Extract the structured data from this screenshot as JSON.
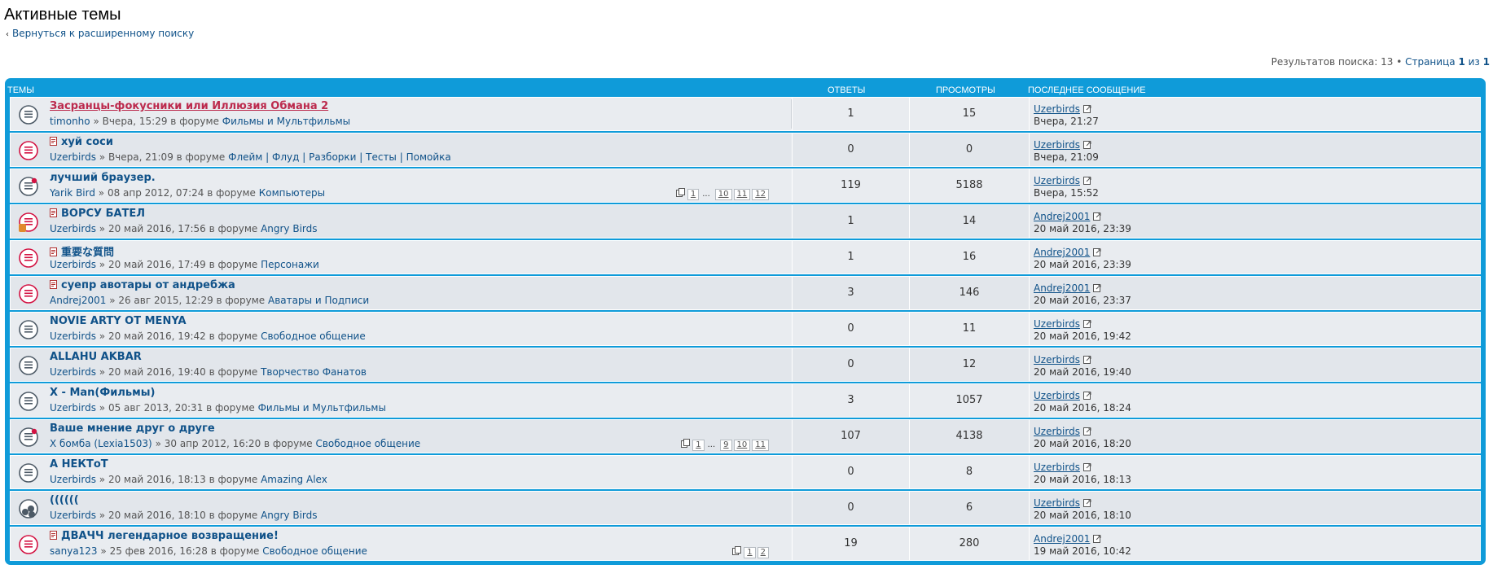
{
  "page": {
    "title": "Активные темы",
    "return_link": "Вернуться к расширенному поиску",
    "results_text": "Результатов поиска: 13",
    "separator": "•",
    "page_text": "Страница",
    "page_current": "1",
    "page_of": "из",
    "page_total": "1"
  },
  "table": {
    "headers": {
      "topics": "ТЕМЫ",
      "replies": "ОТВЕТЫ",
      "views": "ПРОСМОТРЫ",
      "last_post": "ПОСЛЕДНЕЕ СООБЩЕНИЕ"
    },
    "rows": [
      {
        "title": "Засранцы-фокусники или Иллюзия Обмана 2",
        "title_style": "red",
        "hot": false,
        "icon": "topic-read-icon",
        "author": "timonho",
        "date": "» Вчера, 15:29 в форуме",
        "forum": "Фильмы и Мультфильмы",
        "pages": [],
        "replies": "1",
        "views": "15",
        "last_author": "Uzerbirds",
        "last_time": "Вчера, 21:27"
      },
      {
        "title": "хуй соси",
        "title_style": "normal",
        "hot": true,
        "icon": "topic-hot-icon",
        "author": "Uzerbirds",
        "date": "» Вчера, 21:09 в форуме",
        "forum": "Флейм | Флуд | Разборки | Тесты | Помойка",
        "pages": [],
        "replies": "0",
        "views": "0",
        "last_author": "Uzerbirds",
        "last_time": "Вчера, 21:09"
      },
      {
        "title": "лучший браузер.",
        "title_style": "normal",
        "hot": false,
        "icon": "topic-sticky-icon",
        "author": "Yarik Bird",
        "date": "» 08 апр 2012, 07:24 в форуме",
        "forum": "Компьютеры",
        "pages": [
          "1",
          "...",
          "10",
          "11",
          "12"
        ],
        "replies": "119",
        "views": "5188",
        "last_author": "Uzerbirds",
        "last_time": "Вчера, 15:52"
      },
      {
        "title": "ВОРСУ БАТЕЛ",
        "title_style": "normal",
        "hot": true,
        "icon": "topic-hot-own-icon",
        "author": "Uzerbirds",
        "date": "» 20 май 2016, 17:56 в форуме",
        "forum": "Angry Birds",
        "pages": [],
        "replies": "1",
        "views": "14",
        "last_author": "Andrej2001",
        "last_time": "20 май 2016, 23:39"
      },
      {
        "title": "重要な質問",
        "title_style": "normal",
        "hot": true,
        "icon": "topic-hot-icon",
        "author": "Uzerbirds",
        "date": "» 20 май 2016, 17:49 в форуме",
        "forum": "Персонажи",
        "pages": [],
        "replies": "1",
        "views": "16",
        "last_author": "Andrej2001",
        "last_time": "20 май 2016, 23:39"
      },
      {
        "title": "суепр авотары от андребжа",
        "title_style": "normal",
        "hot": true,
        "icon": "topic-hot-icon",
        "author": "Andrej2001",
        "date": "» 26 авг 2015, 12:29 в форуме",
        "forum": "Аватары и Подписи",
        "pages": [],
        "replies": "3",
        "views": "146",
        "last_author": "Andrej2001",
        "last_time": "20 май 2016, 23:37"
      },
      {
        "title": "NOVIE ARTY OT MENYA",
        "title_style": "normal",
        "hot": false,
        "icon": "topic-read-icon",
        "author": "Uzerbirds",
        "date": "» 20 май 2016, 19:42 в форуме",
        "forum": "Свободное общение",
        "pages": [],
        "replies": "0",
        "views": "11",
        "last_author": "Uzerbirds",
        "last_time": "20 май 2016, 19:42"
      },
      {
        "title": "ALLAHU AKBAR",
        "title_style": "normal",
        "hot": false,
        "icon": "topic-read-icon",
        "author": "Uzerbirds",
        "date": "» 20 май 2016, 19:40 в форуме",
        "forum": "Творчество Фанатов",
        "pages": [],
        "replies": "0",
        "views": "12",
        "last_author": "Uzerbirds",
        "last_time": "20 май 2016, 19:40"
      },
      {
        "title": "X - Man(Фильмы)",
        "title_style": "normal",
        "hot": false,
        "icon": "topic-read-icon",
        "author": "Uzerbirds",
        "date": "» 05 авг 2013, 20:31 в форуме",
        "forum": "Фильмы и Мультфильмы",
        "pages": [],
        "replies": "3",
        "views": "1057",
        "last_author": "Uzerbirds",
        "last_time": "20 май 2016, 18:24"
      },
      {
        "title": "Ваше мнение друг о друге",
        "title_style": "normal",
        "hot": false,
        "icon": "topic-sticky-icon",
        "author": "X бомба (Lexia1503)",
        "date": "» 30 апр 2012, 16:20 в форуме",
        "forum": "Свободное общение",
        "pages": [
          "1",
          "...",
          "9",
          "10",
          "11"
        ],
        "replies": "107",
        "views": "4138",
        "last_author": "Uzerbirds",
        "last_time": "20 май 2016, 18:20"
      },
      {
        "title": "А НЕКТоТ",
        "title_style": "normal",
        "hot": false,
        "icon": "topic-read-icon",
        "author": "Uzerbirds",
        "date": "» 20 май 2016, 18:13 в форуме",
        "forum": "Amazing Alex",
        "pages": [],
        "replies": "0",
        "views": "8",
        "last_author": "Uzerbirds",
        "last_time": "20 май 2016, 18:13"
      },
      {
        "title": "((((((",
        "title_style": "normal",
        "hot": false,
        "icon": "topic-poll-icon",
        "author": "Uzerbirds",
        "date": "» 20 май 2016, 18:10 в форуме",
        "forum": "Angry Birds",
        "pages": [],
        "replies": "0",
        "views": "6",
        "last_author": "Uzerbirds",
        "last_time": "20 май 2016, 18:10"
      },
      {
        "title": "ДВАЧЧ легендарное возвращение!",
        "title_style": "normal",
        "hot": true,
        "icon": "topic-hot-icon",
        "author": "sanya123",
        "date": "» 25 фев 2016, 16:28 в форуме",
        "forum": "Свободное общение",
        "pages": [
          "1",
          "2"
        ],
        "replies": "19",
        "views": "280",
        "last_author": "Andrej2001",
        "last_time": "19 май 2016, 10:42"
      }
    ]
  },
  "colors": {
    "accent": "#0f9bd9",
    "link": "#105289",
    "hot": "#d31141",
    "unread_title": "#bc2a4d"
  }
}
